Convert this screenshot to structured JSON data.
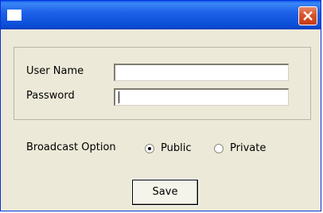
{
  "form": {
    "username_label": "User Name",
    "username_value": "",
    "password_label": "Password",
    "password_value": "",
    "broadcast_label": "Broadcast Option",
    "options": [
      {
        "label": "Public",
        "selected": true
      },
      {
        "label": "Private",
        "selected": false
      }
    ],
    "save_label": "Save"
  },
  "colors": {
    "titlebar": "#0b4fd8",
    "window_bg": "#ece9d8",
    "close_button": "#d9542b"
  }
}
